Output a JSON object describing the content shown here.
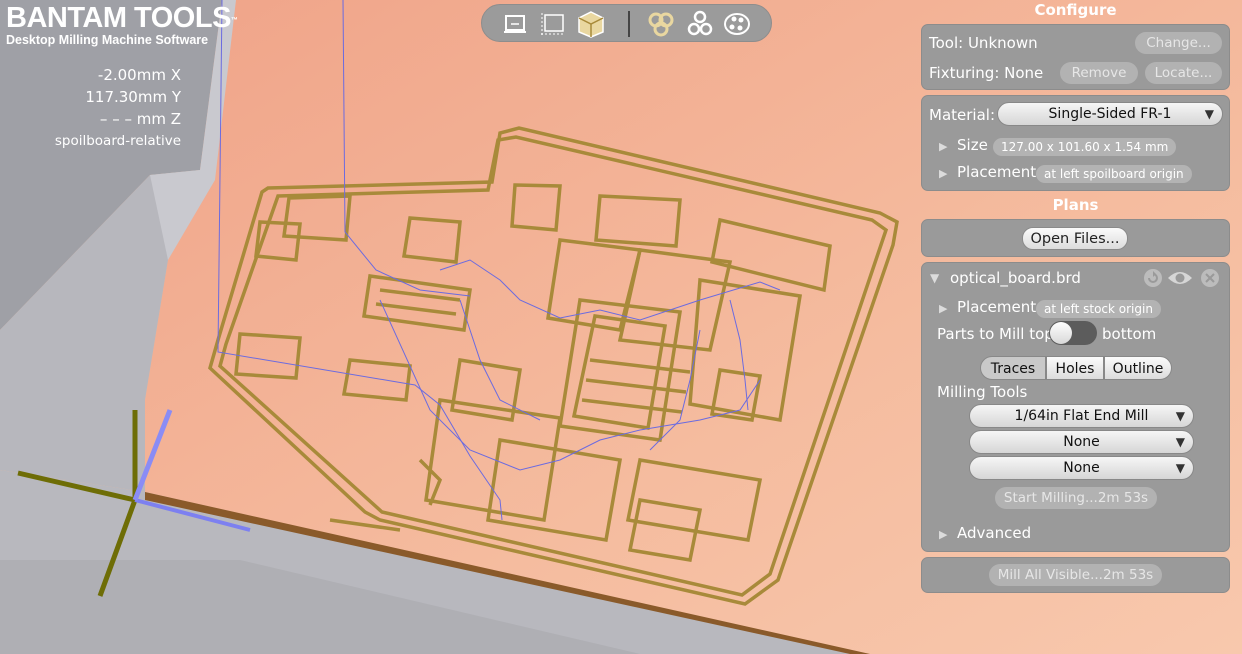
{
  "brand": {
    "title": "BANTAM TOOLS",
    "trademark": "™",
    "subtitle": "Desktop Milling Machine Software"
  },
  "position": {
    "x": "-2.00mm X",
    "y": "117.30mm Y",
    "z": "– – – mm Z",
    "mode": "spoilboard-relative"
  },
  "viewbar": {
    "buttons": [
      "front-view-icon",
      "top-view-icon",
      "iso-view-icon",
      "traces-display-icon",
      "parts-display-icon",
      "holes-display-icon"
    ]
  },
  "configure": {
    "title": "Configure",
    "tool_label": "Tool: Unknown",
    "change_button": "Change...",
    "fixturing_label": "Fixturing: None",
    "remove_button": "Remove",
    "locate_button": "Locate...",
    "material_label": "Material:",
    "material_value": "Single-Sided FR-1",
    "size_label": "Size",
    "size_value": "127.00 x 101.60 x 1.54 mm",
    "placement_label": "Placement",
    "placement_value": "at left spoilboard origin"
  },
  "plans": {
    "title": "Plans",
    "open_files_button": "Open Files...",
    "file": {
      "name": "optical_board.brd",
      "placement_label": "Placement",
      "placement_value": "at left stock origin",
      "parts_label": "Parts to Mill top",
      "parts_bottom_label": "bottom",
      "tabs": [
        "Traces",
        "Holes",
        "Outline"
      ],
      "active_tab": "Traces",
      "milling_tools_label": "Milling Tools",
      "tools": [
        "1/64in Flat End Mill",
        "None",
        "None"
      ],
      "start_button": "Start Milling...2m 53s",
      "advanced_label": "Advanced"
    },
    "mill_all_button": "Mill All Visible...2m 53s"
  },
  "colors": {
    "stock": "#f3b89a",
    "copper": "#a88a3a",
    "panel": "#9a9a9a",
    "machine": "#b9b9bf",
    "toolpath": "#6b6be0"
  }
}
